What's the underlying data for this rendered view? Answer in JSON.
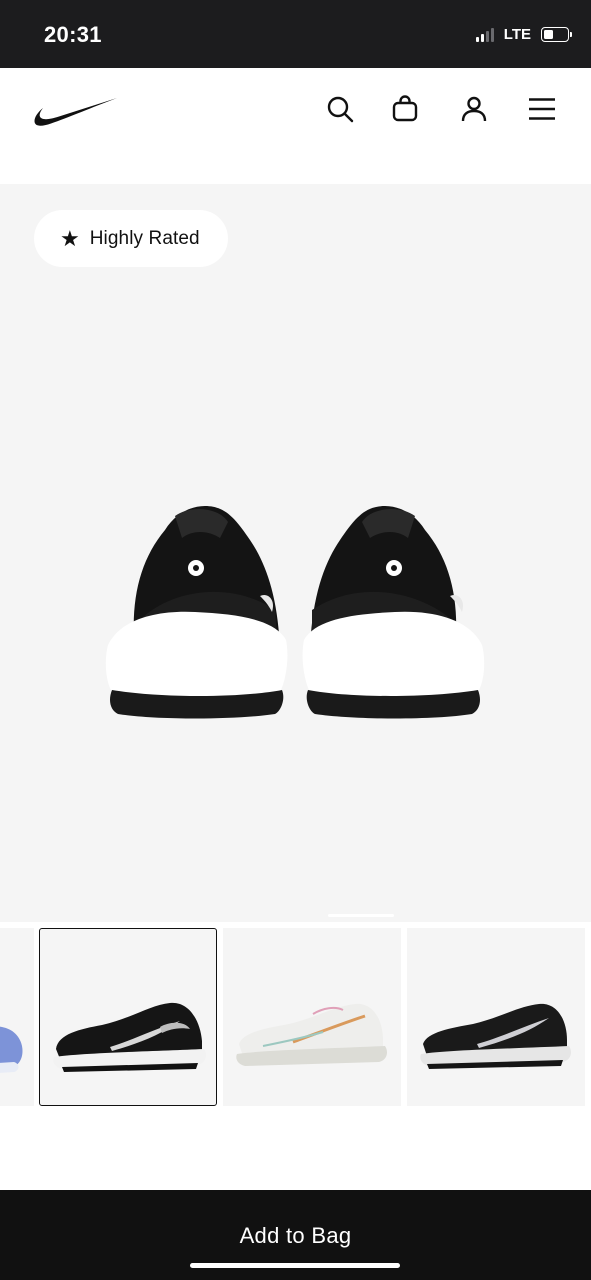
{
  "status_bar": {
    "time": "20:31",
    "network": "LTE"
  },
  "header": {
    "logo": "nike-swoosh-logo",
    "icons": [
      "search-icon",
      "bag-icon",
      "account-icon",
      "menu-icon"
    ]
  },
  "hero": {
    "badge": {
      "icon": "star-icon",
      "label": "Highly Rated"
    },
    "image": "shoes-rear-view"
  },
  "thumbnails": [
    {
      "image": "shoe-blue-partial",
      "selected": false
    },
    {
      "image": "shoe-black-white",
      "selected": true
    },
    {
      "image": "shoe-white-multicolor",
      "selected": false
    },
    {
      "image": "shoe-black-grey",
      "selected": false
    }
  ],
  "cta": {
    "label": "Add to Bag"
  },
  "colors": {
    "status_bar_bg": "#1c1c1e",
    "cta_bg": "#111111",
    "hero_bg": "#f5f5f5"
  }
}
